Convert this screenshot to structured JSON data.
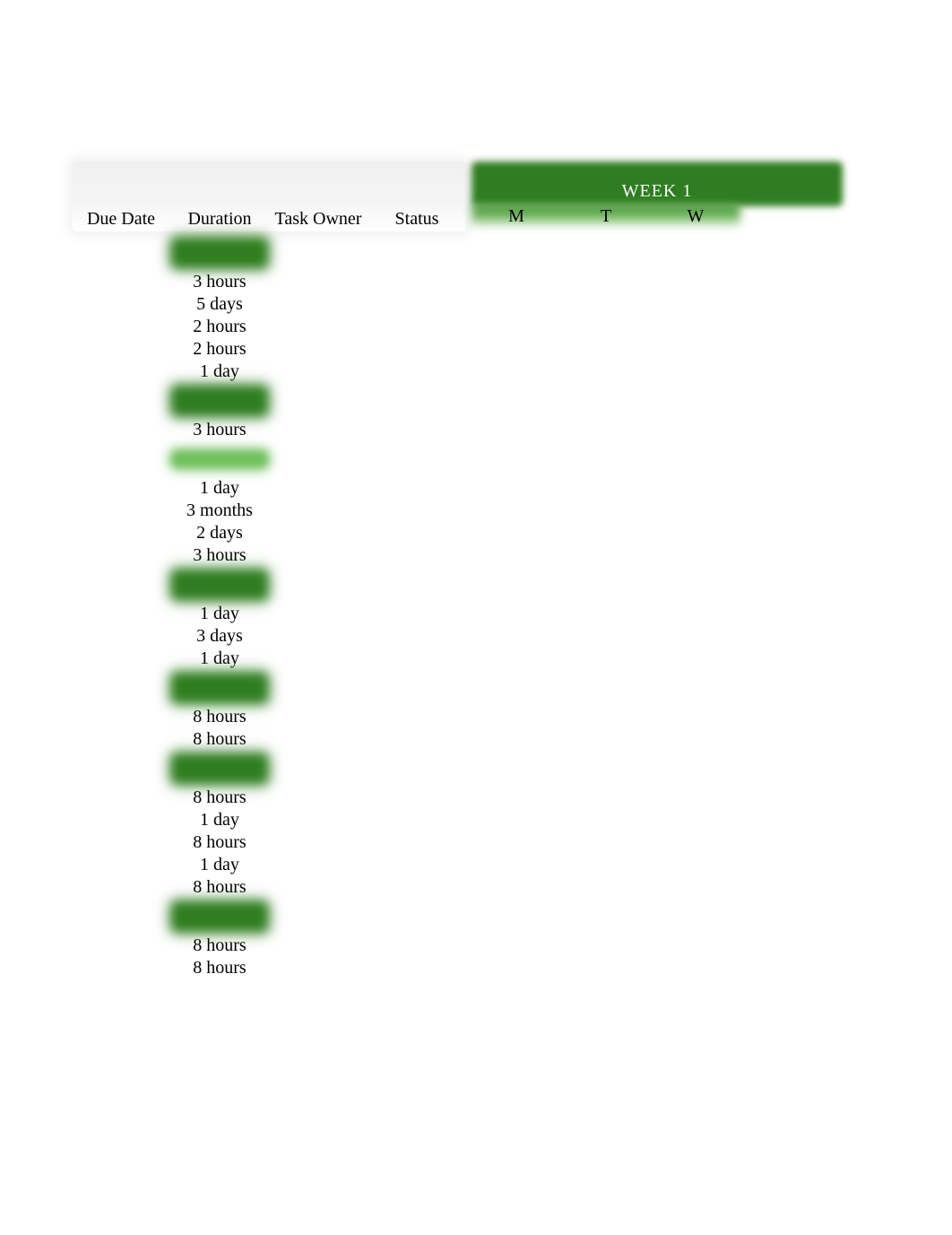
{
  "header": {
    "columns": {
      "due": "Due Date",
      "dur": "Duration",
      "owner": "Task Owner",
      "status": "Status"
    },
    "week_label": "WEEK 1",
    "days": [
      "M",
      "T",
      "W"
    ]
  },
  "rows": [
    {
      "type": "section"
    },
    {
      "type": "task",
      "duration": "3 hours"
    },
    {
      "type": "task",
      "duration": "5 days"
    },
    {
      "type": "task",
      "duration": "2 hours"
    },
    {
      "type": "task",
      "duration": "2 hours"
    },
    {
      "type": "task",
      "duration": "1 day"
    },
    {
      "type": "section"
    },
    {
      "type": "task",
      "duration": "3 hours"
    },
    {
      "type": "section_light"
    },
    {
      "type": "task",
      "duration": "1 day"
    },
    {
      "type": "task",
      "duration": "3 months"
    },
    {
      "type": "task",
      "duration": "2 days"
    },
    {
      "type": "task",
      "duration": "3 hours"
    },
    {
      "type": "section"
    },
    {
      "type": "task",
      "duration": "1 day"
    },
    {
      "type": "task",
      "duration": "3 days"
    },
    {
      "type": "task",
      "duration": "1 day"
    },
    {
      "type": "section"
    },
    {
      "type": "task",
      "duration": "8 hours"
    },
    {
      "type": "task",
      "duration": "8 hours"
    },
    {
      "type": "section"
    },
    {
      "type": "task",
      "duration": "8 hours"
    },
    {
      "type": "task",
      "duration": "1 day"
    },
    {
      "type": "task",
      "duration": "8 hours"
    },
    {
      "type": "task",
      "duration": "1 day"
    },
    {
      "type": "task",
      "duration": "8 hours"
    },
    {
      "type": "section"
    },
    {
      "type": "task",
      "duration": "8 hours"
    },
    {
      "type": "task",
      "duration": "8 hours"
    }
  ]
}
